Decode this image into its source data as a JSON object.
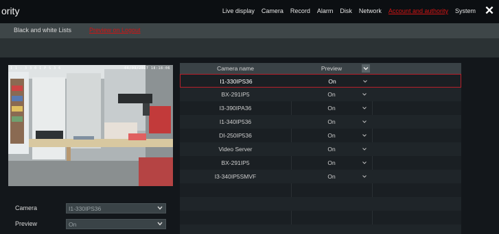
{
  "app": {
    "title": "ority"
  },
  "topnav": {
    "items": [
      {
        "label": "Live display"
      },
      {
        "label": "Camera"
      },
      {
        "label": "Record"
      },
      {
        "label": "Alarm"
      },
      {
        "label": "Disk"
      },
      {
        "label": "Network"
      },
      {
        "label": "Account and authority"
      },
      {
        "label": "System"
      }
    ],
    "close_icon": "close-icon"
  },
  "subtabs": [
    {
      "label": "Black and white Lists"
    },
    {
      "label": "Preview on Logout"
    }
  ],
  "preview": {
    "osd_left": "I 1 - 3 3 0 I P S 3 6",
    "osd_right": "06/09/2017 18:18:06"
  },
  "form": {
    "camera_label": "Camera",
    "camera_value": "I1-330IPS36",
    "preview_label": "Preview",
    "preview_value": "On"
  },
  "table": {
    "headers": {
      "camera": "Camera name",
      "preview": "Preview"
    },
    "rows": [
      {
        "camera": "I1-330IPS36",
        "preview": "On"
      },
      {
        "camera": "BX-291IP5",
        "preview": "On"
      },
      {
        "camera": "I3-390IPA36",
        "preview": "On"
      },
      {
        "camera": "I1-340IP536",
        "preview": "On"
      },
      {
        "camera": "DI-250IP536",
        "preview": "On"
      },
      {
        "camera": "Video Server",
        "preview": "On"
      },
      {
        "camera": "BX-291IP5",
        "preview": "On"
      },
      {
        "camera": "I3-340IP5SMVF",
        "preview": "On"
      }
    ]
  },
  "colors": {
    "accent_red": "#d21414",
    "selected_border": "#b8202a"
  }
}
